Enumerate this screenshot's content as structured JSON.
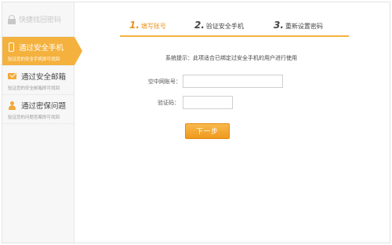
{
  "sidebar": {
    "header_title": "快捷找回密码",
    "items": [
      {
        "title": "通过安全手机",
        "subtitle": "验证您的安全手机即可找回",
        "icon": "phone-icon",
        "active": true
      },
      {
        "title": "通过安全邮箱",
        "subtitle": "验证您的安全邮箱即可找回",
        "icon": "mail-icon",
        "active": false
      },
      {
        "title": "通过密保问题",
        "subtitle": "验证您的问题答案即可找回",
        "icon": "user-icon",
        "active": false
      }
    ]
  },
  "steps": [
    {
      "num": "1.",
      "label": "填写账号",
      "active": true
    },
    {
      "num": "2.",
      "label": "验证安全手机",
      "active": false
    },
    {
      "num": "3.",
      "label": "重新设置密码",
      "active": false
    }
  ],
  "notice": "系统提示：此项适合已绑定过安全手机的用户进行使用",
  "form": {
    "account_label": "空中网账号：",
    "account_value": "",
    "captcha_label": "验证码：",
    "captcha_value": ""
  },
  "next_button": "下一步",
  "colors": {
    "accent": "#f4b13e",
    "accent_text": "#e8931f"
  }
}
